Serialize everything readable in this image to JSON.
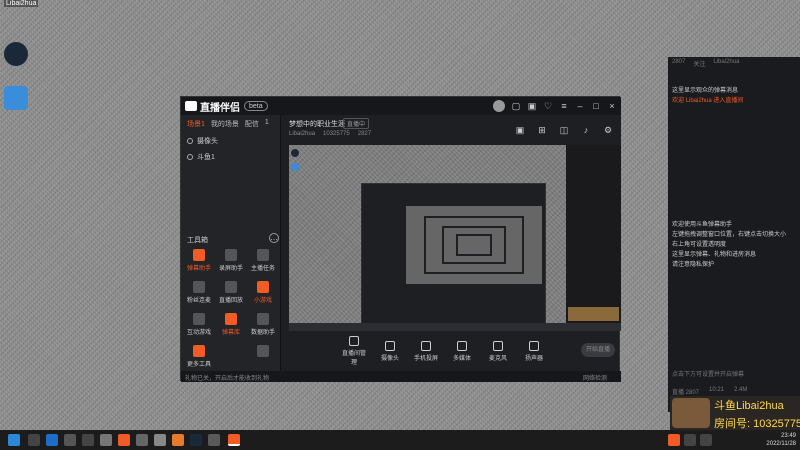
{
  "desktop": {
    "top_label": "Libai2hua"
  },
  "app": {
    "logo_text": "直播伴侣",
    "version_pill": "beta",
    "left_tabs": [
      "场景1",
      "我的场景",
      "配信",
      "1"
    ],
    "scenes": [
      "摄像头",
      "斗鱼1"
    ],
    "tools_title": "工具箱",
    "tools": [
      "弹幕助手",
      "录屏助手",
      "主播任务",
      "粉丝连麦",
      "直播回放",
      "小游戏",
      "互动游戏",
      "弹幕库",
      "数据助手",
      "",
      "更多工具",
      ""
    ],
    "room_title": "梦想中的职业生涯",
    "room_tag": "直播中",
    "room_stats": [
      "Libai2hua",
      "10325775",
      "2827"
    ],
    "controls": [
      "直播间管理",
      "摄像头",
      "手机投屏",
      "多媒体",
      "麦克风",
      "扬声器"
    ],
    "start_label": "开始直播",
    "status_left": "礼物已关，开启后才能收到礼物",
    "status_right": "网络检测"
  },
  "chat": {
    "top_items": [
      "2807",
      "关注",
      "Libai2hua"
    ],
    "lines": [
      "这里显示观众的弹幕消息",
      "欢迎 Libai2hua 进入直播间",
      "欢迎使用斗鱼弹幕助手",
      "左键拖拽调整窗口位置，右键点击切换大小",
      "右上角可设置透明度",
      "这里显示弹幕、礼物和进房消息",
      "请注意隐私保护"
    ],
    "footer": "点击下方可设置并开启弹幕",
    "bottom_info": [
      "直播 2807",
      "10:21",
      "2.4M"
    ]
  },
  "brand": {
    "name": "斗鱼Libai2hua",
    "room": "房间号: 10325775"
  },
  "clock": {
    "time": "23:49",
    "date": "2022/11/28"
  }
}
